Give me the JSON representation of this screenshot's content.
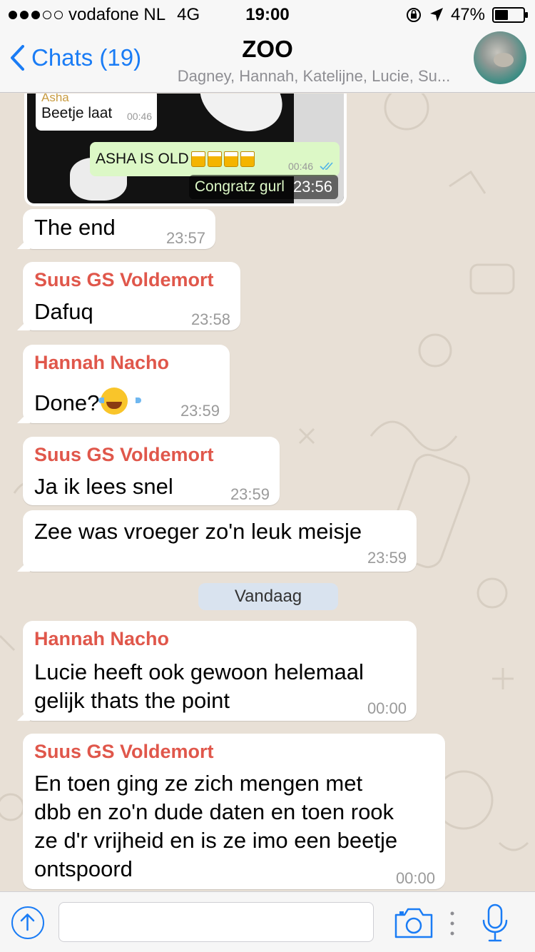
{
  "status_bar": {
    "carrier": "vodafone NL",
    "network": "4G",
    "time": "19:00",
    "battery": "47%",
    "battery_level": 0.47,
    "signal_bars": 3,
    "signal_total": 5
  },
  "nav": {
    "back_label": "Chats (19)",
    "title": "ZOO",
    "subtitle": "Dagney, Hannah, Katelijne, Lucie, Su..."
  },
  "image_message": {
    "quoted_sender": "Asha",
    "quoted_text": "Beetje laat",
    "quoted_time": "00:46",
    "out_text": "ASHA IS OLD",
    "out_time": "00:46",
    "caption": "Congratz gurl",
    "time": "23:56"
  },
  "messages": [
    {
      "sender": "",
      "text": "The end",
      "time": "23:57"
    },
    {
      "sender": "Suus GS Voldemort",
      "text": "Dafuq",
      "time": "23:58"
    },
    {
      "sender": "Hannah Nacho",
      "text": "Done?",
      "time": "23:59"
    },
    {
      "sender": "Suus GS Voldemort",
      "text": "Ja ik lees snel",
      "time": "23:59"
    },
    {
      "sender": "",
      "text": "Zee was vroeger zo'n leuk meisje",
      "time": "23:59"
    },
    {
      "sender": "Hannah Nacho",
      "text": "Lucie heeft ook gewoon helemaal\ngelijk thats the point",
      "time": "00:00"
    },
    {
      "sender": "Suus GS Voldemort",
      "text": "En toen ging ze zich mengen met\ndbb en zo'n dude daten en toen rook\nze d'r vrijheid en is ze imo een beetje\nontspoord",
      "time": "00:00"
    }
  ],
  "date_divider": "Vandaag",
  "input": {
    "value": "",
    "placeholder": ""
  },
  "colors": {
    "accent": "#1a7cf5",
    "sender_name": "#e0574b",
    "outgoing": "#dcf8c6"
  }
}
